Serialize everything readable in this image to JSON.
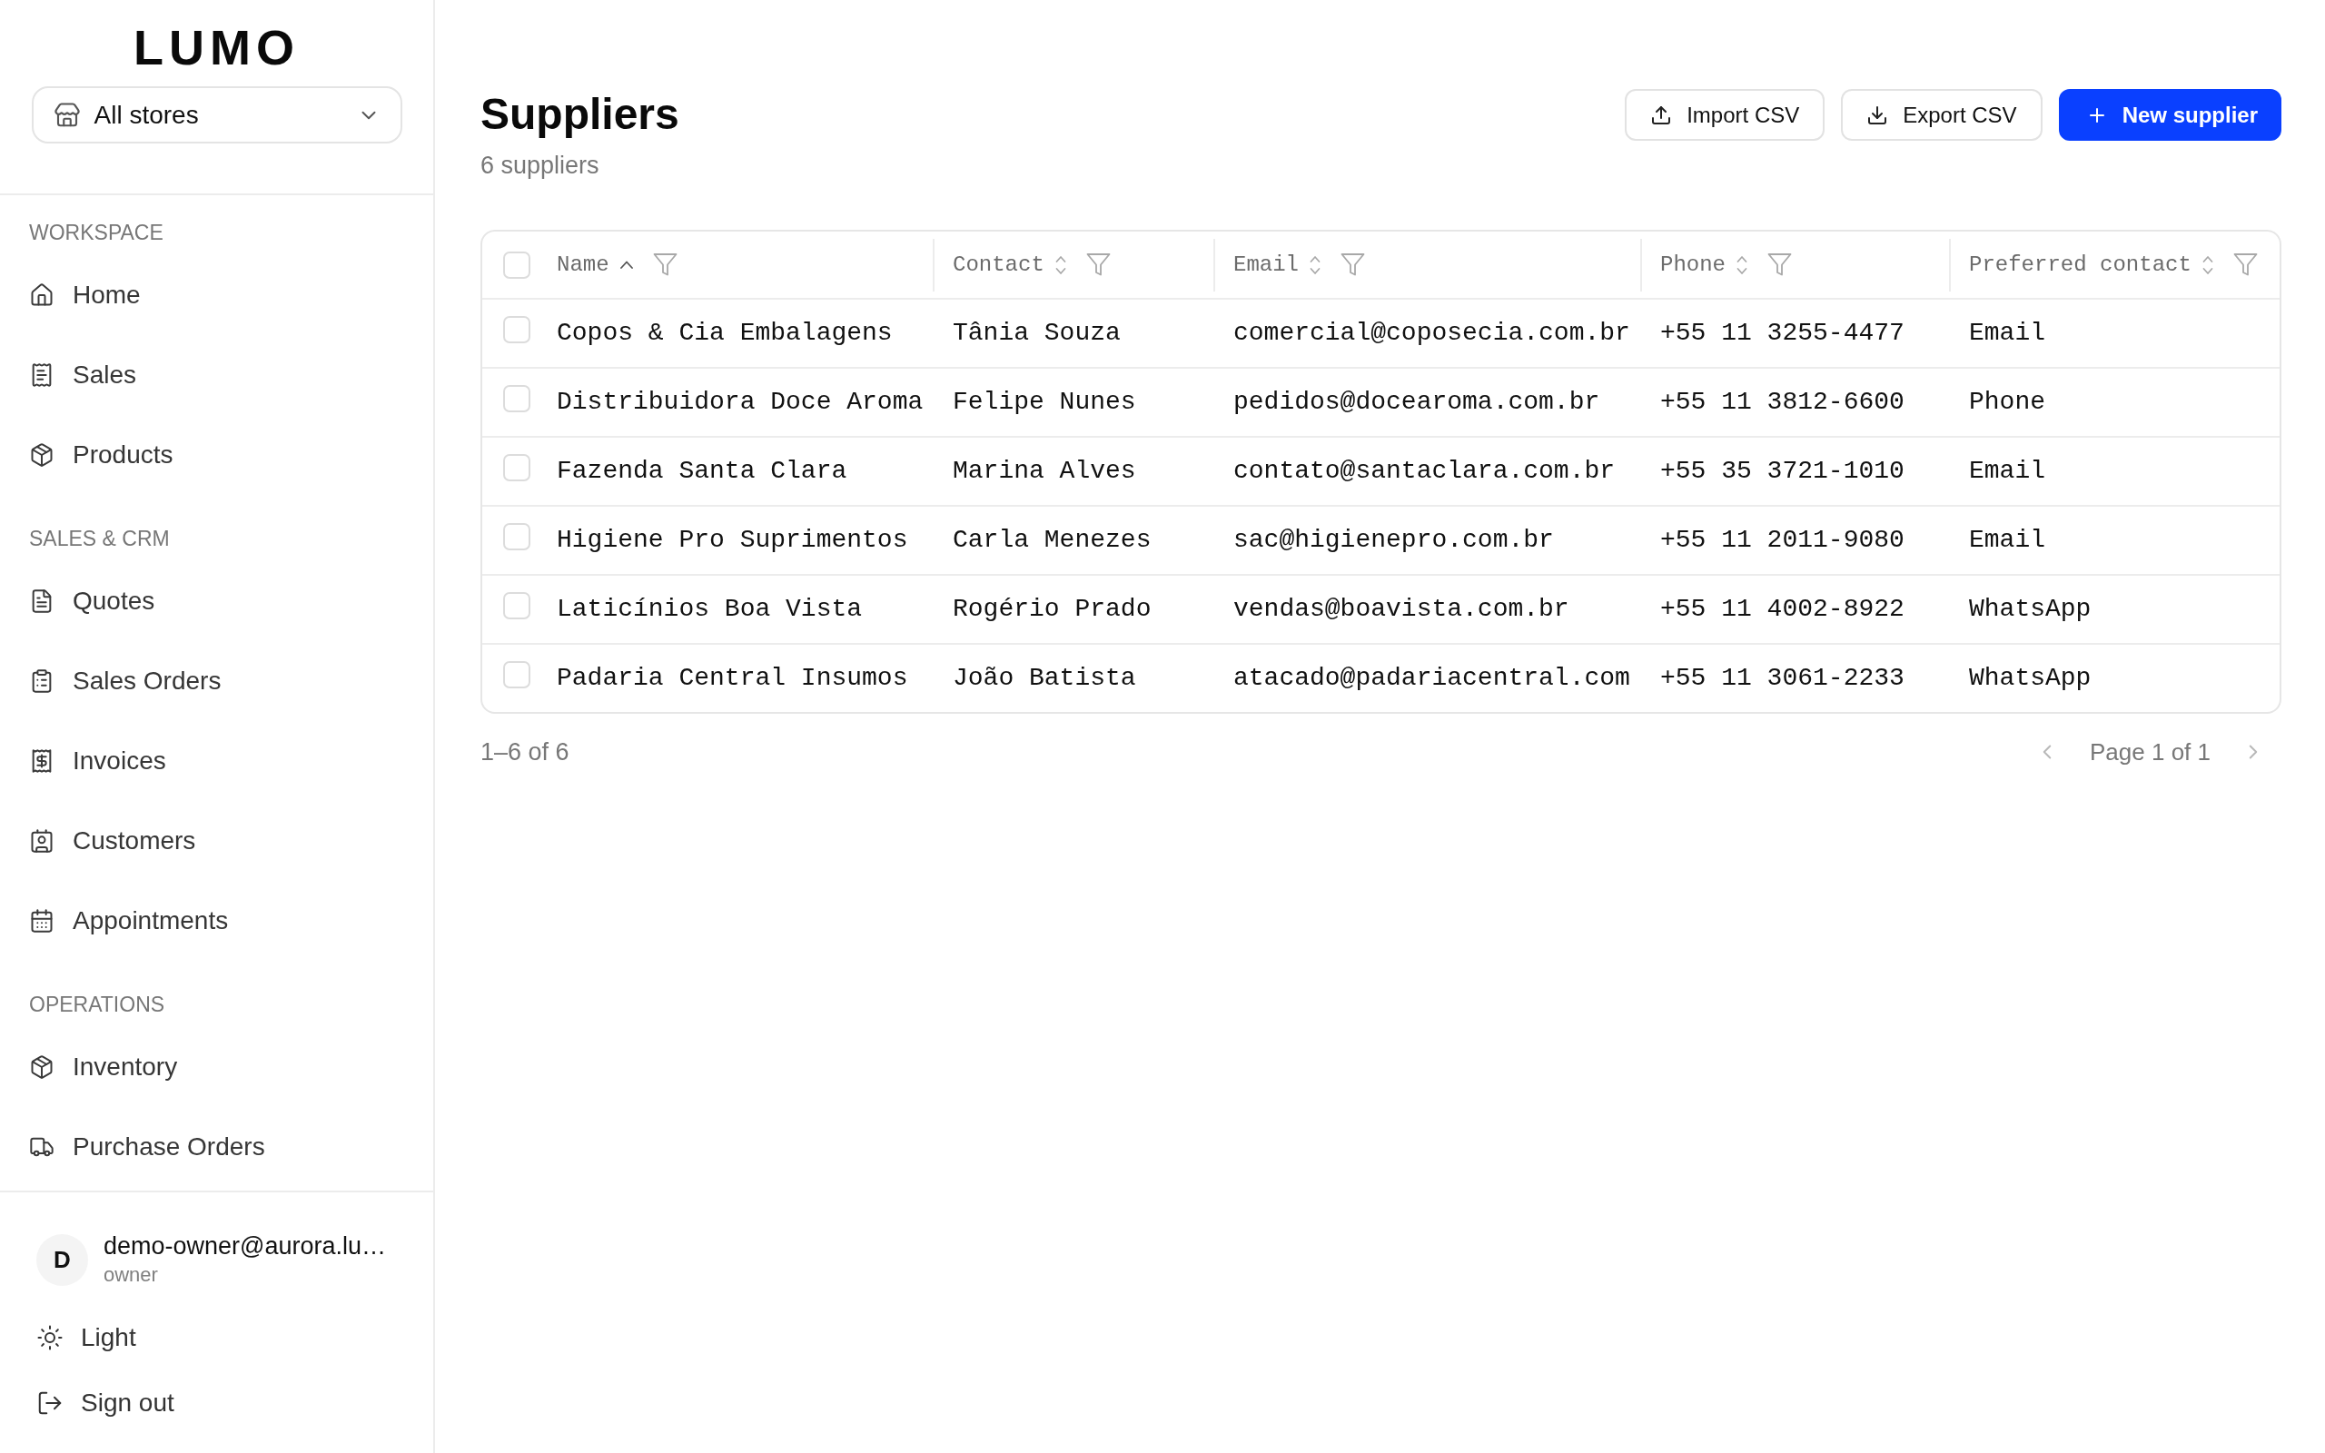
{
  "sidebar": {
    "logo": "LUMO",
    "store_selector": {
      "value": "All stores"
    },
    "sections": [
      {
        "title": "WORKSPACE",
        "items": [
          {
            "label": "Home",
            "selected": false
          },
          {
            "label": "Sales",
            "selected": false
          },
          {
            "label": "Products",
            "selected": false
          }
        ]
      },
      {
        "title": "SALES & CRM",
        "items": [
          {
            "label": "Quotes",
            "selected": false
          },
          {
            "label": "Sales Orders",
            "selected": false
          },
          {
            "label": "Invoices",
            "selected": false
          },
          {
            "label": "Customers",
            "selected": false
          },
          {
            "label": "Appointments",
            "selected": false
          }
        ]
      },
      {
        "title": "OPERATIONS",
        "items": [
          {
            "label": "Inventory",
            "selected": false
          },
          {
            "label": "Purchase Orders",
            "selected": false
          }
        ]
      }
    ],
    "user": {
      "initial": "D",
      "email": "demo-owner@aurora.lu…",
      "role": "owner"
    },
    "actions": [
      "Light",
      "Sign out"
    ]
  },
  "header": {
    "title": "Suppliers",
    "subtitle": "6 suppliers",
    "buttons": [
      {
        "label": "Import CSV",
        "kind": "secondary"
      },
      {
        "label": "Export CSV",
        "kind": "secondary"
      },
      {
        "label": "New supplier",
        "kind": "primary"
      }
    ]
  },
  "table": {
    "select_all": {
      "checked": false
    },
    "columns": [
      {
        "label": "Name",
        "sorted": true
      },
      {
        "label": "Contact",
        "sorted": false
      },
      {
        "label": "Email",
        "sorted": false
      },
      {
        "label": "Phone",
        "sorted": false
      },
      {
        "label": "Preferred contact",
        "sorted": false
      }
    ],
    "rows": [
      {
        "checked": false,
        "name": "Copos & Cia Embalagens",
        "contact": "Tânia Souza",
        "email": "comercial@coposecia.com.br",
        "phone": "+55 11 3255-4477",
        "preferred_contact": "Email"
      },
      {
        "checked": false,
        "name": "Distribuidora Doce Aroma",
        "contact": "Felipe Nunes",
        "email": "pedidos@docearoma.com.br",
        "phone": "+55 11 3812-6600",
        "preferred_contact": "Phone"
      },
      {
        "checked": false,
        "name": "Fazenda Santa Clara",
        "contact": "Marina Alves",
        "email": "contato@santaclara.com.br",
        "phone": "+55 35 3721-1010",
        "preferred_contact": "Email"
      },
      {
        "checked": false,
        "name": "Higiene Pro Suprimentos",
        "contact": "Carla Menezes",
        "email": "sac@higienepro.com.br",
        "phone": "+55 11 2011-9080",
        "preferred_contact": "Email"
      },
      {
        "checked": false,
        "name": "Laticínios Boa Vista",
        "contact": "Rogério Prado",
        "email": "vendas@boavista.com.br",
        "phone": "+55 11 4002-8922",
        "preferred_contact": "WhatsApp"
      },
      {
        "checked": false,
        "name": "Padaria Central Insumos",
        "contact": "João Batista",
        "email": "atacado@padariacentral.com",
        "phone": "+55 11 3061-2233",
        "preferred_contact": "WhatsApp"
      }
    ]
  },
  "pagination": {
    "summary": "1–6 of 6",
    "page": "Page 1 of 1",
    "previous": {
      "disabled": true
    },
    "next": {
      "disabled": true
    }
  }
}
